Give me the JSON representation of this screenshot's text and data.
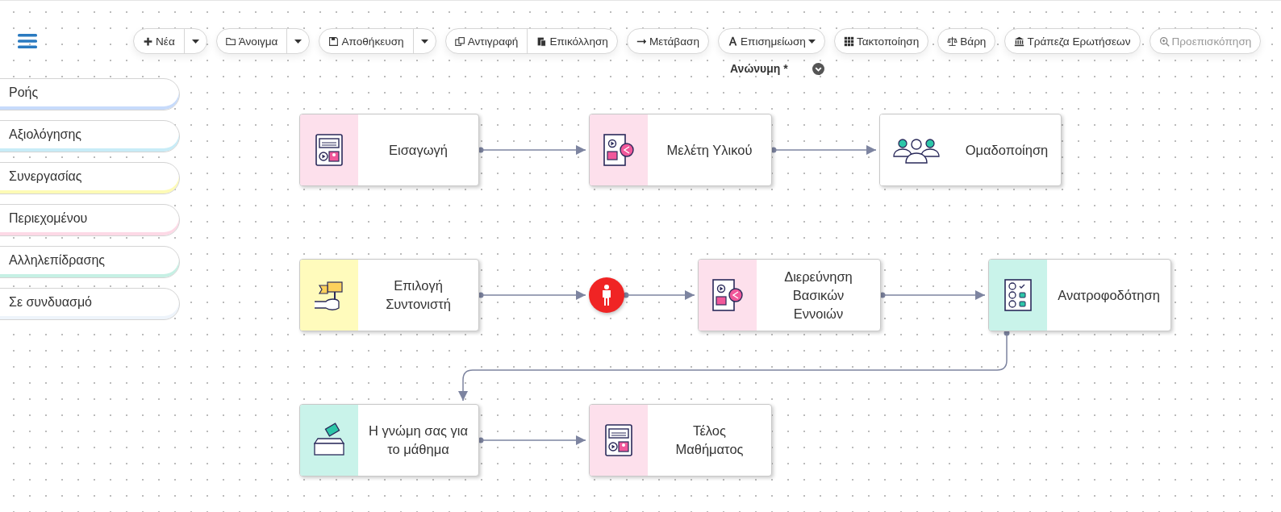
{
  "toolbar": [
    {
      "buttons": [
        {
          "label": "Νέα",
          "disabled": false
        }
      ],
      "dropdown": true,
      "caret": false
    },
    {
      "buttons": [
        {
          "label": "Άνοιγμα",
          "disabled": false
        }
      ],
      "dropdown": true,
      "caret": false
    },
    {
      "buttons": [
        {
          "label": "Αποθήκευση",
          "disabled": false
        }
      ],
      "dropdown": true,
      "caret": false
    },
    {
      "buttons": [
        {
          "label": "Αντιγραφή",
          "disabled": false
        },
        {
          "label": "Επικόλληση",
          "disabled": false
        }
      ],
      "dropdown": false,
      "caret": false
    },
    {
      "buttons": [
        {
          "label": "Μετάβαση",
          "disabled": false
        }
      ],
      "dropdown": false,
      "caret": false
    },
    {
      "buttons": [
        {
          "label": "Επισημείωση",
          "disabled": false
        }
      ],
      "dropdown": false,
      "caret": true
    },
    {
      "buttons": [
        {
          "label": "Τακτοποίηση",
          "disabled": false
        }
      ],
      "dropdown": false,
      "caret": false
    },
    {
      "buttons": [
        {
          "label": "Βάρη",
          "disabled": false
        }
      ],
      "dropdown": false,
      "caret": false
    },
    {
      "buttons": [
        {
          "label": "Τράπεζα Ερωτήσεων",
          "disabled": false
        }
      ],
      "dropdown": false,
      "caret": false
    },
    {
      "buttons": [
        {
          "label": "Προεπισκόπηση",
          "disabled": true
        }
      ],
      "dropdown": false,
      "caret": false
    }
  ],
  "document_title": "Ανώνυμη *",
  "sidebar": {
    "items": [
      {
        "label": "Ροής",
        "color": "#c7dbfb"
      },
      {
        "label": "Αξιολόγησης",
        "color": "#c8ecf7"
      },
      {
        "label": "Συνεργασίας",
        "color": "#fefbb6"
      },
      {
        "label": "Περιεχομένου",
        "color": "#fdd9e6"
      },
      {
        "label": "Αλληλεπίδρασης",
        "color": "#c6f0e4"
      },
      {
        "label": "Σε συνδυασμό",
        "color": "#eef4fb"
      }
    ]
  },
  "diagram": {
    "nodes": [
      {
        "kind": "media",
        "label": "Εισαγωγή",
        "color": "#fde0ec"
      },
      {
        "kind": "share",
        "label": "Μελέτη Υλικού",
        "color": "#fde0ec"
      },
      {
        "kind": "group",
        "label": "Ομαδοποίηση",
        "color": "#ffffff"
      },
      {
        "kind": "flag",
        "label": "Επιλογή\nΣυντονιστή",
        "color": "#fffbbc"
      },
      {
        "kind": "marker",
        "color": "#f02424"
      },
      {
        "kind": "share",
        "label": "Διερεύνηση\nΒασικών\nΕννοιών",
        "color": "#fde0ec"
      },
      {
        "kind": "feedback",
        "label": "Ανατροφοδότηση",
        "color": "#c9f3ea"
      },
      {
        "kind": "vote",
        "label": "Η γνώμη σας για\nτο μάθημα",
        "color": "#c9f3ea"
      },
      {
        "kind": "media",
        "label": "Τέλος\nΜαθήματος",
        "color": "#fde0ec"
      }
    ]
  }
}
